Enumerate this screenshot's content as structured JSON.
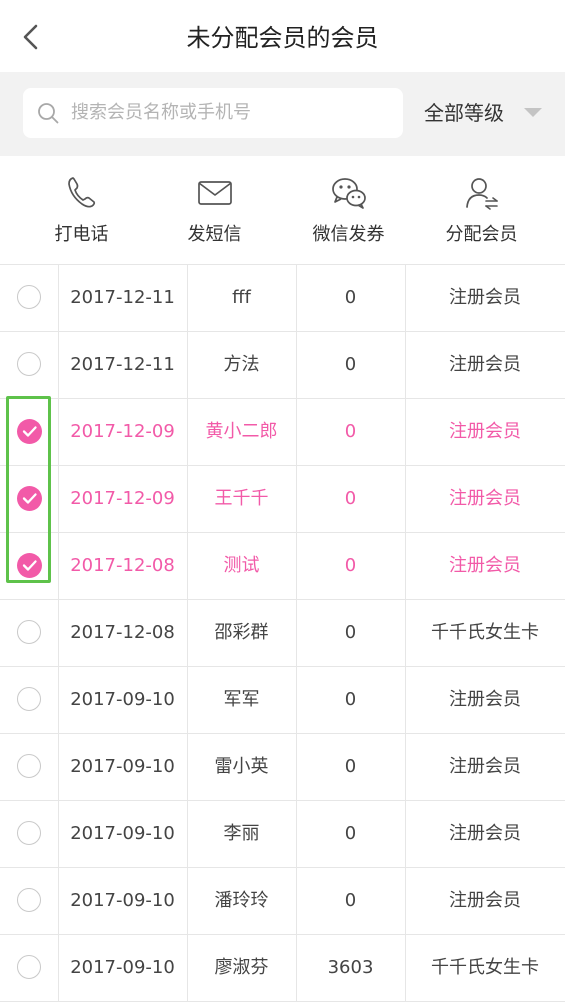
{
  "header": {
    "title": "未分配会员的会员"
  },
  "search": {
    "placeholder": "搜索会员名称或手机号"
  },
  "filter": {
    "grade_label": "全部等级"
  },
  "actions": [
    {
      "label": "打电话",
      "icon": "phone-icon"
    },
    {
      "label": "发短信",
      "icon": "mail-icon"
    },
    {
      "label": "微信发券",
      "icon": "wechat-icon"
    },
    {
      "label": "分配会员",
      "icon": "assign-member-icon"
    }
  ],
  "colors": {
    "accent": "#f25aa8",
    "highlight": "#5ec24a"
  },
  "members": [
    {
      "selected": false,
      "date": "2017-12-11",
      "name": "fff",
      "value": "0",
      "type": "注册会员"
    },
    {
      "selected": false,
      "date": "2017-12-11",
      "name": "方法",
      "value": "0",
      "type": "注册会员"
    },
    {
      "selected": true,
      "date": "2017-12-09",
      "name": "黄小二郎",
      "value": "0",
      "type": "注册会员"
    },
    {
      "selected": true,
      "date": "2017-12-09",
      "name": "王千千",
      "value": "0",
      "type": "注册会员"
    },
    {
      "selected": true,
      "date": "2017-12-08",
      "name": "测试",
      "value": "0",
      "type": "注册会员"
    },
    {
      "selected": false,
      "date": "2017-12-08",
      "name": "邵彩群",
      "value": "0",
      "type": "千千氏女生卡"
    },
    {
      "selected": false,
      "date": "2017-09-10",
      "name": "军军",
      "value": "0",
      "type": "注册会员"
    },
    {
      "selected": false,
      "date": "2017-09-10",
      "name": "雷小英",
      "value": "0",
      "type": "注册会员"
    },
    {
      "selected": false,
      "date": "2017-09-10",
      "name": "李丽",
      "value": "0",
      "type": "注册会员"
    },
    {
      "selected": false,
      "date": "2017-09-10",
      "name": "潘玲玲",
      "value": "0",
      "type": "注册会员"
    },
    {
      "selected": false,
      "date": "2017-09-10",
      "name": "廖淑芬",
      "value": "3603",
      "type": "千千氏女生卡"
    }
  ]
}
